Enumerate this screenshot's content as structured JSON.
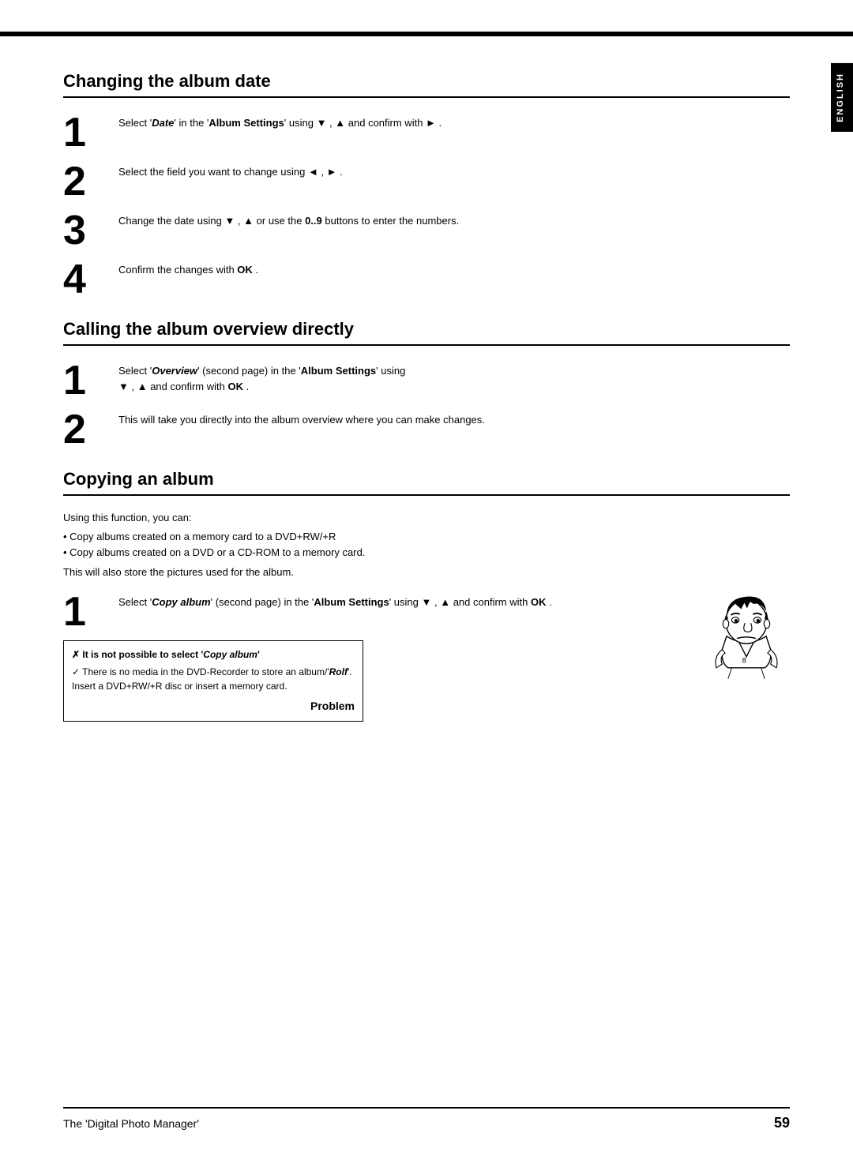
{
  "page": {
    "top_border": true,
    "side_tab_label": "ENGLISH",
    "footer": {
      "left": "The 'Digital Photo Manager'",
      "right": "59"
    }
  },
  "sections": [
    {
      "id": "changing-album-date",
      "heading": "Changing the album date",
      "steps": [
        {
          "num": "1",
          "content": "Select '<em>Date</em>' in the '<strong>Album Settings</strong>' using ▼ , ▲ and confirm with ► ."
        },
        {
          "num": "2",
          "content": "Select the field you want to change using ◄ , ► ."
        },
        {
          "num": "3",
          "content": "Change the date using ▼ , ▲ or use the <strong>0..9</strong> buttons to enter the numbers."
        },
        {
          "num": "4",
          "content": "Confirm the changes with <strong>OK</strong> ."
        }
      ]
    },
    {
      "id": "calling-album-overview",
      "heading": "Calling the album overview directly",
      "steps": [
        {
          "num": "1",
          "content": "Select '<strong><em>Overview</em></strong>' (second page) in the '<strong>Album Settings</strong>' using ▼ , ▲ and confirm with <strong>OK</strong> ."
        },
        {
          "num": "2",
          "content": "This will take you directly into the album overview where you can make changes."
        }
      ]
    },
    {
      "id": "copying-album",
      "heading": "Copying an album",
      "intro_lines": [
        "Using this function, you can:",
        "•  Copy albums created on a memory card to a DVD+RW/+R",
        "•  Copy albums created on a DVD or a CD-ROM to a memory card.",
        "This will also store the pictures used for the album."
      ],
      "steps": [
        {
          "num": "1",
          "content": "Select '<strong><em>Copy album</em></strong>' (second page) in the '<strong>Album Settings</strong>' using ▼ , ▲ and confirm with <strong>OK</strong> ."
        }
      ],
      "problem_box": {
        "cross_item": "It is not possible to select 'Copy album'",
        "check_item": "There is no media in the DVD-Recorder to store an album/'Rolf'. Insert a DVD+RW/+R disc or insert a memory card.",
        "label": "Problem"
      }
    }
  ]
}
